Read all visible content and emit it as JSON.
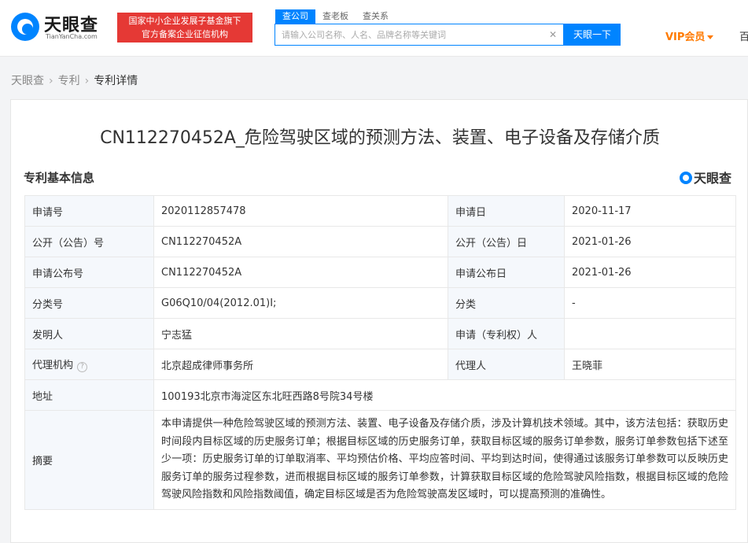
{
  "header": {
    "logo_cn": "天眼查",
    "logo_en": "TianYanCha.com",
    "gov_badge_line1": "国家中小企业发展子基金旗下",
    "gov_badge_line2": "官方备案企业征信机构",
    "tabs": [
      "查公司",
      "查老板",
      "查关系"
    ],
    "search_placeholder": "请输入公司名称、人名、品牌名称等关键词",
    "search_button": "天眼一下",
    "vip": "VIP会员",
    "nav_cut": "百"
  },
  "breadcrumb": [
    "天眼查",
    "专利",
    "专利详情"
  ],
  "patent": {
    "title": "CN112270452A_危险驾驶区域的预测方法、装置、电子设备及存储介质",
    "section_title": "专利基本信息",
    "watermark": "天眼查",
    "rows": [
      {
        "l1": "申请号",
        "v1": "2020112857478",
        "l2": "申请日",
        "v2": "2020-11-17"
      },
      {
        "l1": "公开（公告）号",
        "v1": "CN112270452A",
        "l2": "公开（公告）日",
        "v2": "2021-01-26"
      },
      {
        "l1": "申请公布号",
        "v1": "CN112270452A",
        "l2": "申请公布日",
        "v2": "2021-01-26"
      },
      {
        "l1": "分类号",
        "v1": "G06Q10/04(2012.01)I;",
        "l2": "分类",
        "v2": "-"
      },
      {
        "l1": "发明人",
        "v1": "宁志猛",
        "l2": "申请（专利权）人",
        "v2": ""
      },
      {
        "l1": "代理机构",
        "v1": "北京超成律师事务所",
        "l2": "代理人",
        "v2": "王晓菲"
      }
    ],
    "address_label": "地址",
    "address": "100193北京市海淀区东北旺西路8号院34号楼",
    "abstract_label": "摘要",
    "abstract": "本申请提供一种危险驾驶区域的预测方法、装置、电子设备及存储介质，涉及计算机技术领域。其中，该方法包括：获取历史时间段内目标区域的历史服务订单；根据目标区域的历史服务订单，获取目标区域的服务订单参数，服务订单参数包括下述至少一项：历史服务订单的订单取消率、平均预估价格、平均应答时间、平均到达时间，使得通过该服务订单参数可以反映历史服务订单的服务过程参数，进而根据目标区域的服务订单参数，计算获取目标区域的危险驾驶风险指数，根据目标区域的危险驾驶风险指数和风险指数阈值，确定目标区域是否为危险驾驶高发区域时，可以提高预测的准确性。"
  }
}
